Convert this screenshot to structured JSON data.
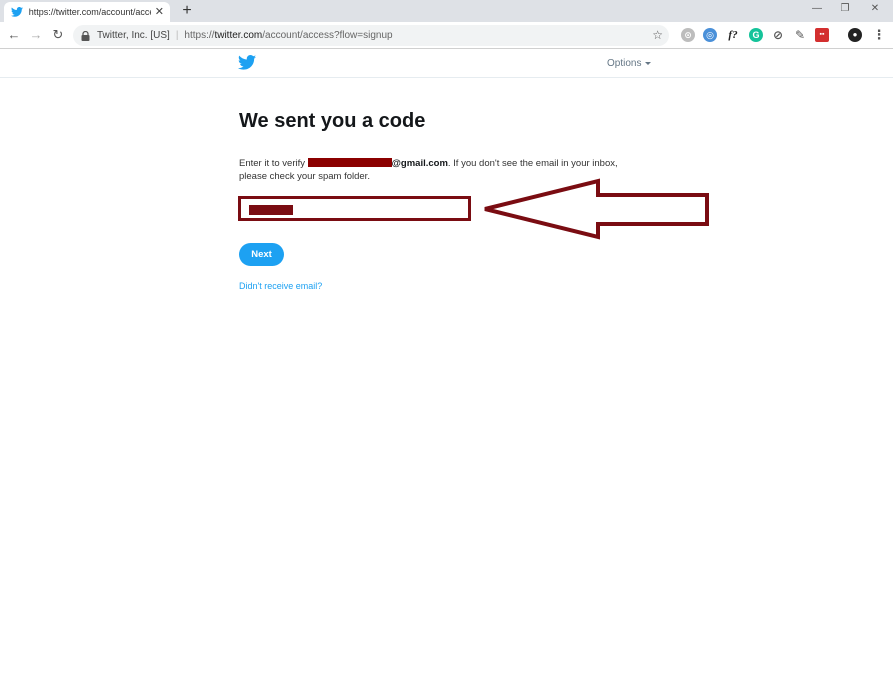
{
  "browser": {
    "tab_title": "https://twitter.com/account/acce",
    "tab_close": "✕",
    "new_tab": "+",
    "window_controls": [
      "—",
      "❐",
      "✕"
    ],
    "nav": {
      "back": "←",
      "forward": "→",
      "reload": "↻"
    },
    "site_name": "Twitter, Inc. [US]",
    "url_scheme": "https://",
    "url_host": "twitter.com",
    "url_path": "/account/access?flow=signup",
    "star": "☆",
    "extensions": [
      {
        "name": "history-icon",
        "label": "⊙",
        "color": "#bdbdbd"
      },
      {
        "name": "globe-icon",
        "label": "◎",
        "color": "#4a90d9"
      },
      {
        "name": "font-icon",
        "label": "f?",
        "color": "#222222"
      },
      {
        "name": "grammarly-icon",
        "label": "G",
        "color": "#15c39a"
      },
      {
        "name": "compass-icon",
        "label": "⊘",
        "color": "#555555"
      },
      {
        "name": "eyedropper-icon",
        "label": "✎",
        "color": "#555555"
      },
      {
        "name": "red-ext-icon",
        "label": "▪▪",
        "color": "#d32f2f"
      },
      {
        "name": "profile-icon",
        "label": "●",
        "color": "#222222"
      },
      {
        "name": "menu-icon",
        "label": "⋮",
        "color": "#555555"
      }
    ]
  },
  "header": {
    "options_label": "Options"
  },
  "main": {
    "heading": "We sent you a code",
    "instr_prefix": "Enter it to verify ",
    "email_domain": "@gmail.com",
    "instr_suffix": ". If you don't see the email in your inbox, please check your spam folder.",
    "next_label": "Next",
    "resend_label": "Didn't receive email?"
  },
  "colors": {
    "twitter_blue": "#1da1f2",
    "annotation_red": "#7a0c12"
  }
}
